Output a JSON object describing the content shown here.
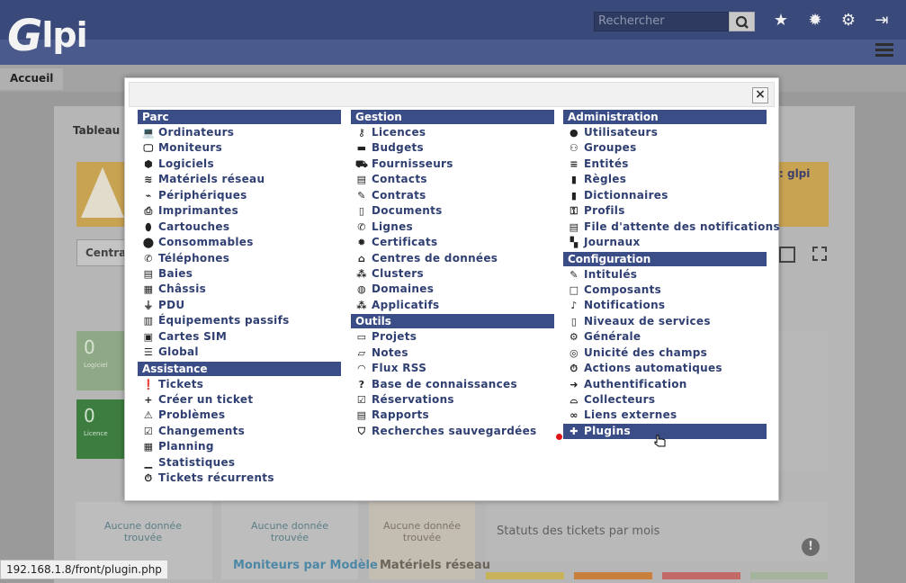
{
  "app": {
    "logo": "glpi"
  },
  "header": {
    "search_placeholder": "Rechercher",
    "icons": [
      "search-icon",
      "star-icon",
      "bug-icon",
      "gear-icon",
      "sign-out-icon",
      "menu-icon"
    ]
  },
  "breadcrumb": {
    "home": "Accueil"
  },
  "dashboard": {
    "title": "Tableau d",
    "user_hint": ": glpi",
    "selector": "Centra",
    "cards": [
      {
        "value": "0",
        "label": "Logiciel"
      },
      {
        "value": "0",
        "label": "Licence"
      }
    ],
    "no_data": [
      "Aucune donnée trouvée",
      "Aucune donnée trouvée",
      "Aucune donnée trouvée"
    ],
    "widget_titles": [
      "Moniteurs par Modèle",
      "Matériels réseau"
    ],
    "tickets_widget": "Statuts des tickets par mois"
  },
  "statusbar": {
    "url": "192.168.1.8/front/plugin.php"
  },
  "menu": {
    "close_label": "×",
    "columns": [
      {
        "sections": [
          {
            "title": "Parc",
            "items": [
              {
                "label": "Ordinateurs",
                "icon": "💻",
                "icon_name": "laptop-icon"
              },
              {
                "label": "Moniteurs",
                "icon": "🖵",
                "icon_name": "desktop-icon"
              },
              {
                "label": "Logiciels",
                "icon": "⬢",
                "icon_name": "cube-icon"
              },
              {
                "label": "Matériels réseau",
                "icon": "≋",
                "icon_name": "network-icon"
              },
              {
                "label": "Périphériques",
                "icon": "⌁",
                "icon_name": "usb-icon"
              },
              {
                "label": "Imprimantes",
                "icon": "⎙",
                "icon_name": "print-icon"
              },
              {
                "label": "Cartouches",
                "icon": "⬮",
                "icon_name": "fill-drip-icon"
              },
              {
                "label": "Consommables",
                "icon": "⬤",
                "icon_name": "box-icon"
              },
              {
                "label": "Téléphones",
                "icon": "✆",
                "icon_name": "phone-icon"
              },
              {
                "label": "Baies",
                "icon": "▤",
                "icon_name": "server-icon"
              },
              {
                "label": "Châssis",
                "icon": "▦",
                "icon_name": "th-icon"
              },
              {
                "label": "PDU",
                "icon": "⏚",
                "icon_name": "plug-icon"
              },
              {
                "label": "Équipements passifs",
                "icon": "▥",
                "icon_name": "th-list-icon"
              },
              {
                "label": "Cartes SIM",
                "icon": "▣",
                "icon_name": "sim-card-icon"
              },
              {
                "label": "Global",
                "icon": "☰",
                "icon_name": "list-icon"
              }
            ]
          },
          {
            "title": "Assistance",
            "items": [
              {
                "label": "Tickets",
                "icon": "❗",
                "icon_name": "exclamation-circle-icon"
              },
              {
                "label": "Créer un ticket",
                "icon": "+",
                "icon_name": "plus-icon"
              },
              {
                "label": "Problèmes",
                "icon": "⚠",
                "icon_name": "warning-icon"
              },
              {
                "label": "Changements",
                "icon": "☑",
                "icon_name": "clipboard-check-icon"
              },
              {
                "label": "Planning",
                "icon": "▦",
                "icon_name": "calendar-icon"
              },
              {
                "label": "Statistiques",
                "icon": "▁",
                "icon_name": "chart-bar-icon"
              },
              {
                "label": "Tickets récurrents",
                "icon": "⏱",
                "icon_name": "stopwatch-icon"
              }
            ]
          }
        ]
      },
      {
        "sections": [
          {
            "title": "Gestion",
            "items": [
              {
                "label": "Licences",
                "icon": "⚷",
                "icon_name": "key-icon"
              },
              {
                "label": "Budgets",
                "icon": "▬",
                "icon_name": "calculator-icon"
              },
              {
                "label": "Fournisseurs",
                "icon": "⛟",
                "icon_name": "dolly-icon"
              },
              {
                "label": "Contacts",
                "icon": "▤",
                "icon_name": "user-tie-icon"
              },
              {
                "label": "Contrats",
                "icon": "✎",
                "icon_name": "file-signature-icon"
              },
              {
                "label": "Documents",
                "icon": "▯",
                "icon_name": "file-icon"
              },
              {
                "label": "Lignes",
                "icon": "✆",
                "icon_name": "phone-alt-icon"
              },
              {
                "label": "Certificats",
                "icon": "✹",
                "icon_name": "certificate-icon"
              },
              {
                "label": "Centres de données",
                "icon": "⌂",
                "icon_name": "warehouse-icon"
              },
              {
                "label": "Clusters",
                "icon": "⁂",
                "icon_name": "project-diagram-icon"
              },
              {
                "label": "Domaines",
                "icon": "◍",
                "icon_name": "globe-icon"
              },
              {
                "label": "Applicatifs",
                "icon": "⁂",
                "icon_name": "cubes-icon"
              }
            ]
          },
          {
            "title": "Outils",
            "items": [
              {
                "label": "Projets",
                "icon": "▭",
                "icon_name": "columns-icon"
              },
              {
                "label": "Notes",
                "icon": "▱",
                "icon_name": "sticky-note-icon"
              },
              {
                "label": "Flux RSS",
                "icon": "◠",
                "icon_name": "rss-icon"
              },
              {
                "label": "Base de connaissances",
                "icon": "?",
                "icon_name": "question-icon"
              },
              {
                "label": "Réservations",
                "icon": "☑",
                "icon_name": "calendar-check-icon"
              },
              {
                "label": "Rapports",
                "icon": "▤",
                "icon_name": "book-icon"
              },
              {
                "label": "Recherches sauvegardées",
                "icon": "⛉",
                "icon_name": "bookmark-icon"
              }
            ]
          }
        ]
      },
      {
        "sections": [
          {
            "title": "Administration",
            "items": [
              {
                "label": "Utilisateurs",
                "icon": "●",
                "icon_name": "user-icon"
              },
              {
                "label": "Groupes",
                "icon": "⚇",
                "icon_name": "users-icon"
              },
              {
                "label": "Entités",
                "icon": "≡",
                "icon_name": "layer-group-icon"
              },
              {
                "label": "Règles",
                "icon": "▮",
                "icon_name": "book-rules-icon"
              },
              {
                "label": "Dictionnaires",
                "icon": "▮",
                "icon_name": "book-dictionary-icon"
              },
              {
                "label": "Profils",
                "icon": "⚿",
                "icon_name": "user-check-icon"
              },
              {
                "label": "File d'attente des notifications",
                "icon": "▤",
                "icon_name": "list-alt-icon"
              },
              {
                "label": "Journaux",
                "icon": "▚",
                "icon_name": "scroll-icon"
              }
            ]
          },
          {
            "title": "Configuration",
            "items": [
              {
                "label": "Intitulés",
                "icon": "✎",
                "icon_name": "edit-icon"
              },
              {
                "label": "Composants",
                "icon": "□",
                "icon_name": "square-icon"
              },
              {
                "label": "Notifications",
                "icon": "♪",
                "icon_name": "bell-icon"
              },
              {
                "label": "Niveaux de services",
                "icon": "▯",
                "icon_name": "file-contract-icon"
              },
              {
                "label": "Générale",
                "icon": "⚙",
                "icon_name": "cog-icon"
              },
              {
                "label": "Unicité des champs",
                "icon": "◎",
                "icon_name": "fingerprint-icon"
              },
              {
                "label": "Actions automatiques",
                "icon": "⏱",
                "icon_name": "stopwatch-auto-icon"
              },
              {
                "label": "Authentification",
                "icon": "➜",
                "icon_name": "sign-in-icon"
              },
              {
                "label": "Collecteurs",
                "icon": "⌓",
                "icon_name": "inbox-icon"
              },
              {
                "label": "Liens externes",
                "icon": "∞",
                "icon_name": "link-icon"
              },
              {
                "label": "Plugins",
                "icon": "✚",
                "icon_name": "puzzle-piece-icon",
                "active": true
              }
            ]
          }
        ]
      }
    ]
  }
}
